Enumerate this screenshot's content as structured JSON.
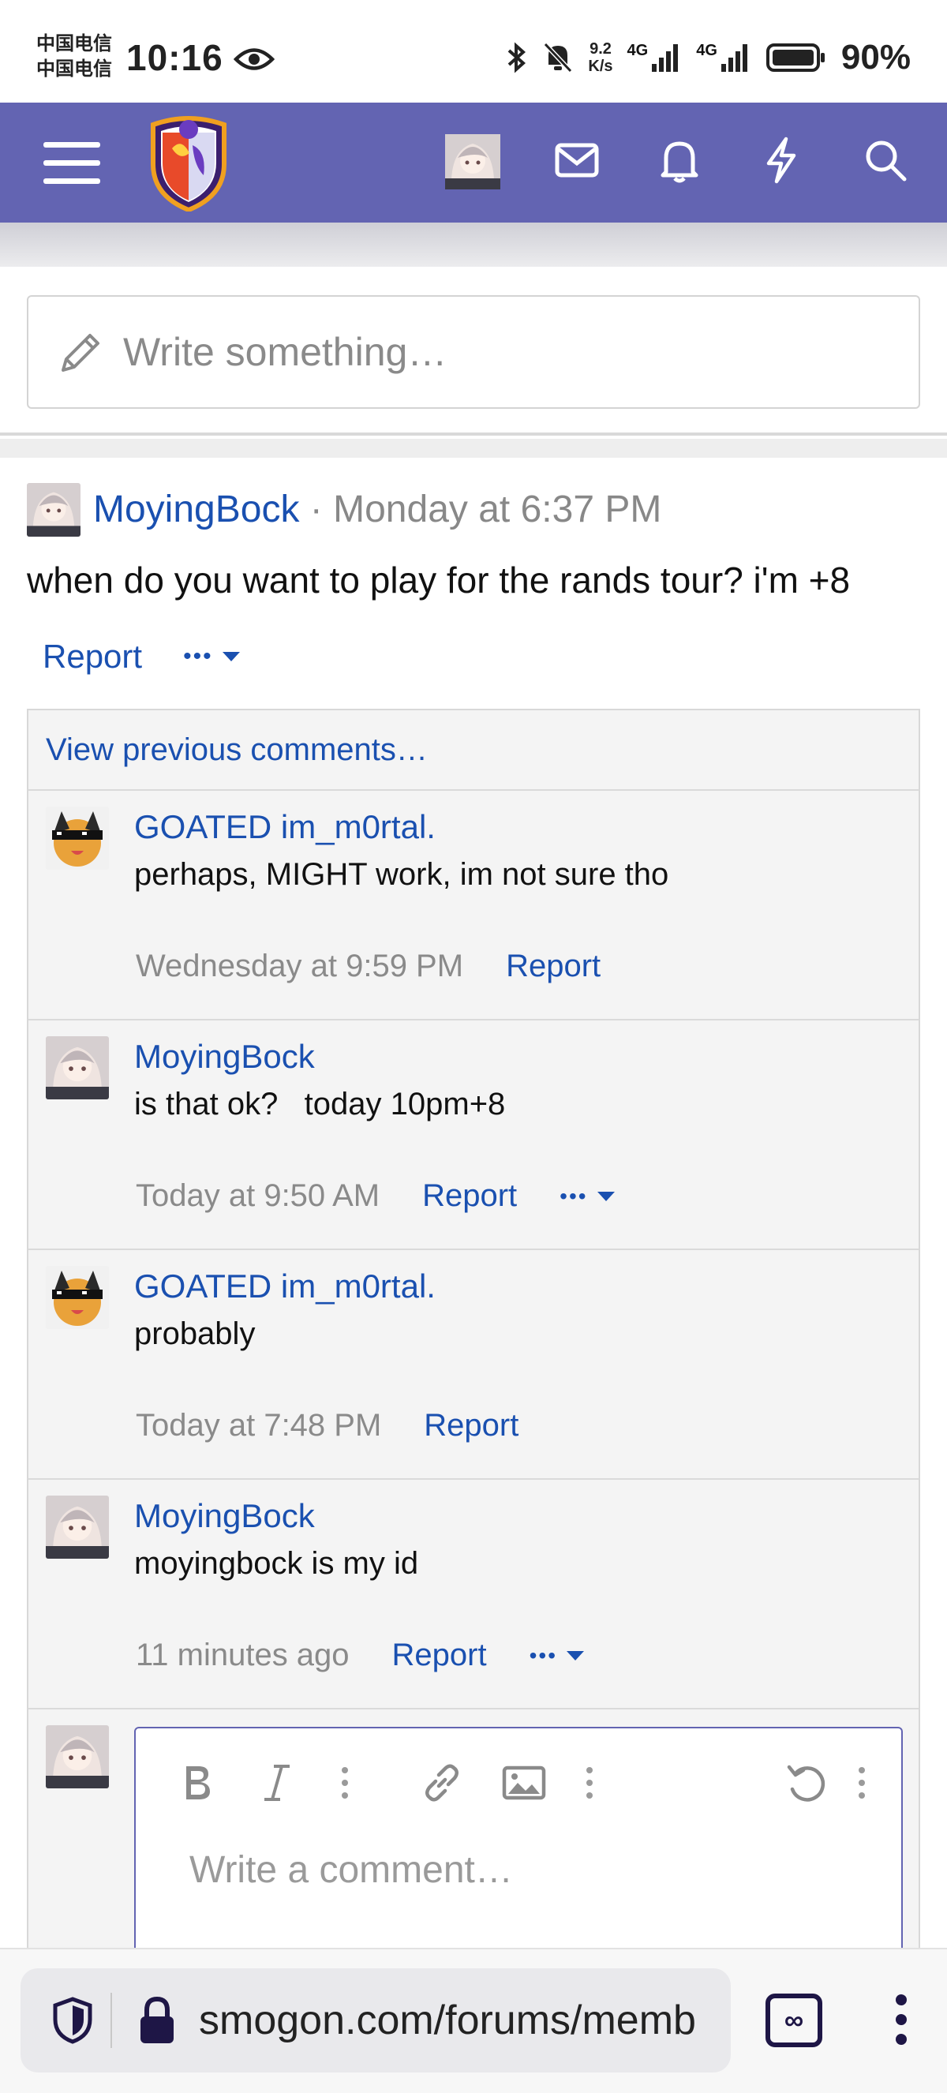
{
  "status_bar": {
    "carrier_1": "中国电信",
    "carrier_2": "中国电信",
    "time": "10:16",
    "net_speed_value": "9.2",
    "net_speed_unit": "K/s",
    "signal_1": "4G",
    "signal_2": "4G",
    "battery_percent": "90%"
  },
  "navbar": {
    "background": "#6364b2",
    "icons": [
      "menu-icon",
      "site-logo",
      "user-avatar",
      "envelope-icon",
      "bell-icon",
      "bolt-icon",
      "search-icon"
    ]
  },
  "composer": {
    "placeholder": "Write something…"
  },
  "post": {
    "author": "MoyingBock",
    "separator": "·",
    "timestamp": "Monday at 6:37 PM",
    "body": "when do you want to play for the rands tour? i'm +8",
    "report_label": "Report",
    "more_label": "•••"
  },
  "comments": {
    "view_previous": "View previous comments…",
    "items": [
      {
        "author": "GOATED im_m0rtal.",
        "text": "perhaps, MIGHT work, im not sure tho",
        "time": "Wednesday at 9:59 PM",
        "report": "Report",
        "has_more": false
      },
      {
        "author": "MoyingBock",
        "text": "is that ok?   today 10pm+8",
        "time": "Today at 9:50 AM",
        "report": "Report",
        "has_more": true
      },
      {
        "author": "GOATED im_m0rtal.",
        "text": "probably",
        "time": "Today at 7:48 PM",
        "report": "Report",
        "has_more": false
      },
      {
        "author": "MoyingBock",
        "text": "moyingbock is my id",
        "time": "11 minutes ago",
        "report": "Report",
        "has_more": true
      }
    ],
    "more_label": "•••"
  },
  "reply_editor": {
    "placeholder": "Write a comment…",
    "toolbar": [
      "bold-icon",
      "italic-icon",
      "more-text-options-icon",
      "link-icon",
      "image-icon",
      "more-insert-options-icon",
      "undo-icon",
      "more-options-icon"
    ]
  },
  "browser": {
    "url": "smogon.com/forums/memb",
    "tab_symbol": "∞",
    "accent": "#1e1646"
  }
}
